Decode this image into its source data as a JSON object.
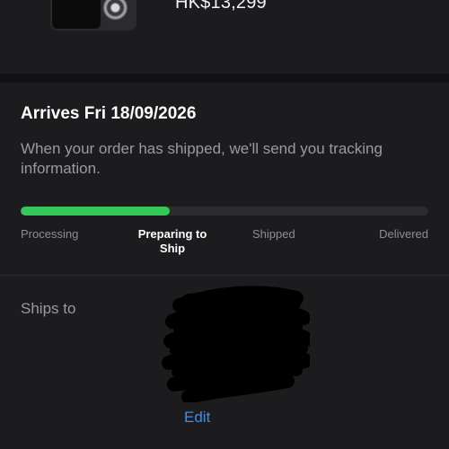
{
  "product": {
    "price": "HK$13,299"
  },
  "delivery": {
    "title": "Arrives Fri 18/09/2026",
    "description": "When your order has shipped, we'll send you tracking information.",
    "progress_fraction": 0.365,
    "progress_color": "#34c759",
    "steps": [
      {
        "label": "Processing",
        "active": false
      },
      {
        "label": "Preparing to Ship",
        "active": true
      },
      {
        "label": "Shipped",
        "active": false
      },
      {
        "label": "Delivered",
        "active": false
      }
    ]
  },
  "shipping": {
    "label": "Ships to",
    "edit_label": "Edit",
    "link_color": "#3a8ef6"
  }
}
